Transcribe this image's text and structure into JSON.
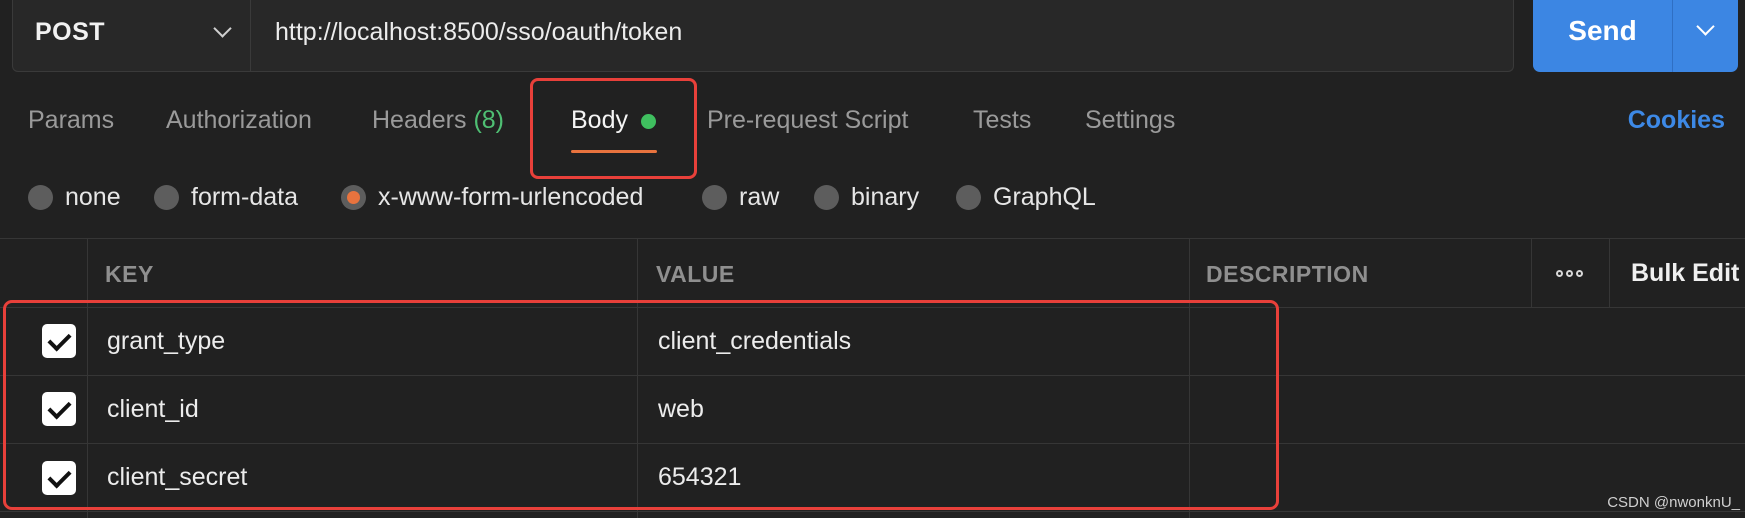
{
  "request": {
    "method": "POST",
    "url": "http://localhost:8500/sso/oauth/token",
    "send_label": "Send"
  },
  "tabs": [
    {
      "label": "Params"
    },
    {
      "label": "Authorization"
    },
    {
      "label": "Headers",
      "count": "(8)"
    },
    {
      "label": "Body",
      "active": true
    },
    {
      "label": "Pre-request Script"
    },
    {
      "label": "Tests"
    },
    {
      "label": "Settings"
    }
  ],
  "cookies_label": "Cookies",
  "body_types": [
    {
      "label": "none"
    },
    {
      "label": "form-data"
    },
    {
      "label": "x-www-form-urlencoded",
      "selected": true
    },
    {
      "label": "raw"
    },
    {
      "label": "binary"
    },
    {
      "label": "GraphQL"
    }
  ],
  "table": {
    "headers": {
      "key": "KEY",
      "value": "VALUE",
      "description": "DESCRIPTION"
    },
    "more_icon": "more-horizontal-icon",
    "bulk_edit_label": "Bulk Edit",
    "rows": [
      {
        "checked": true,
        "key": "grant_type",
        "value": "client_credentials",
        "description": ""
      },
      {
        "checked": true,
        "key": "client_id",
        "value": "web",
        "description": ""
      },
      {
        "checked": true,
        "key": "client_secret",
        "value": "654321",
        "description": ""
      }
    ]
  },
  "annotation_color": "#e8403a",
  "accent_color": "#e8733e",
  "send_color": "#3c86e3",
  "watermark": "CSDN @nwonknU_"
}
